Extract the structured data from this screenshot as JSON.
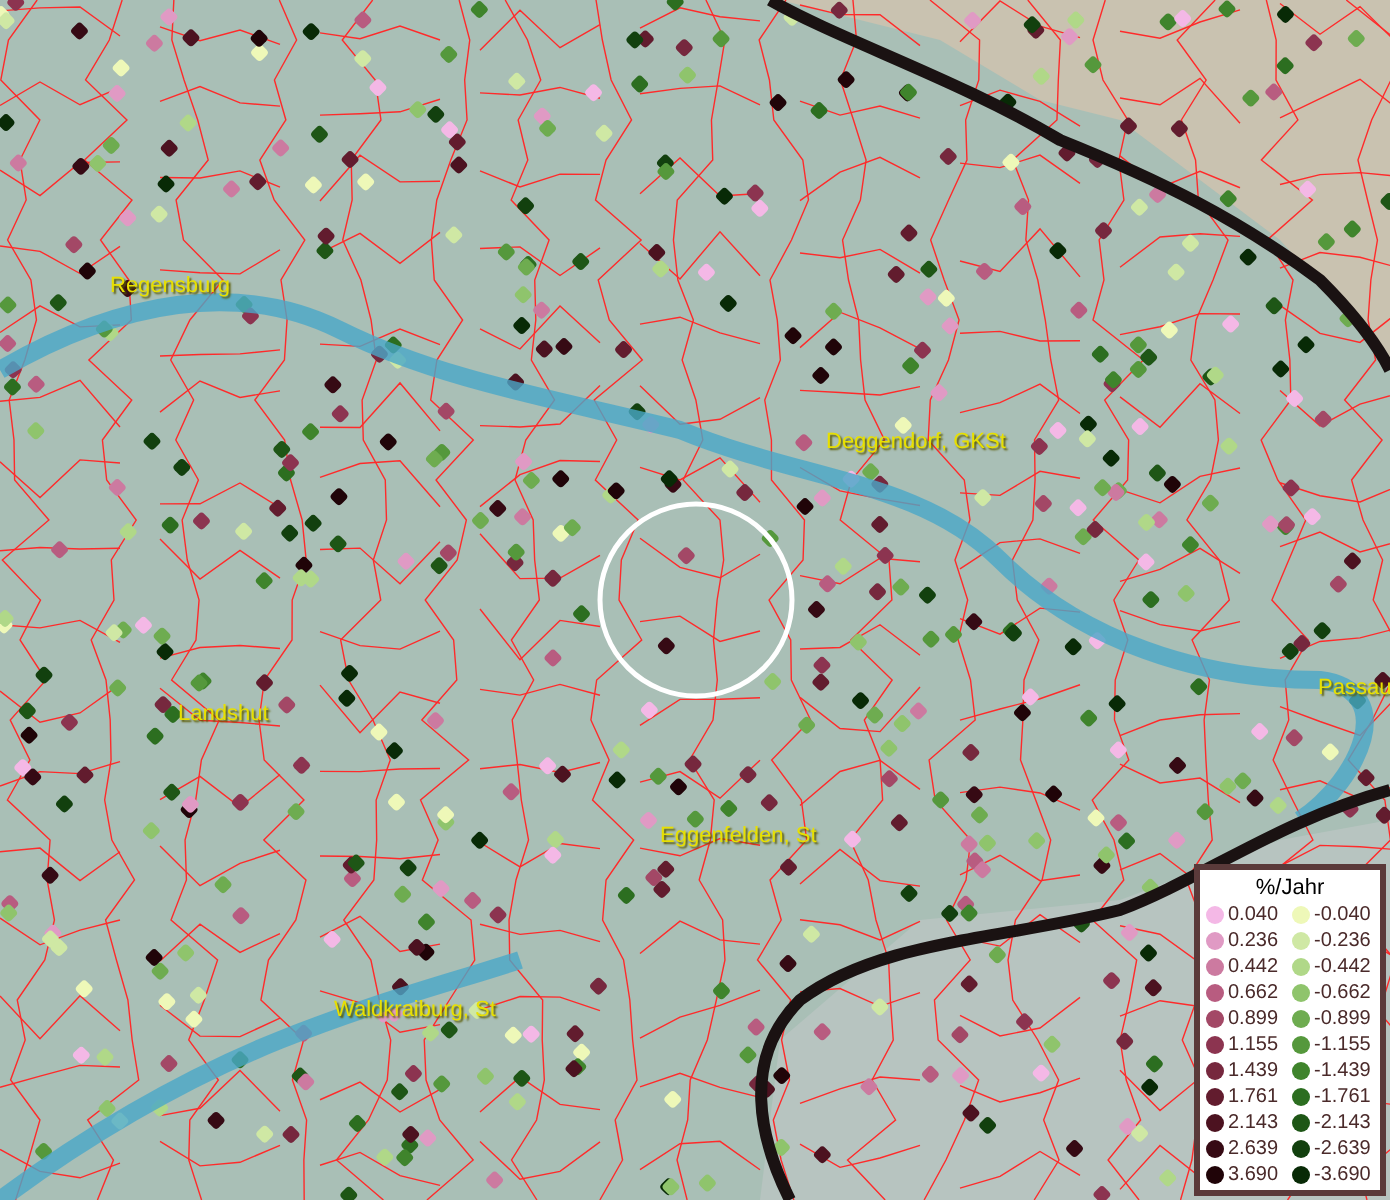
{
  "map": {
    "places": [
      {
        "name": "Regensburg"
      },
      {
        "name": "Deggendorf, GKSt"
      },
      {
        "name": "Landshut"
      },
      {
        "name": "Eggenfelden, St"
      },
      {
        "name": "Waldkraiburg, St"
      },
      {
        "name": "Passau"
      }
    ]
  },
  "legend": {
    "title": "%/Jahr",
    "entries": [
      {
        "value": "0.040",
        "color": "#f4b8e6"
      },
      {
        "value": "-0.040",
        "color": "#eef8b8"
      },
      {
        "value": "0.236",
        "color": "#e09ac4"
      },
      {
        "value": "-0.236",
        "color": "#cfe8a4"
      },
      {
        "value": "0.442",
        "color": "#cc7aa0"
      },
      {
        "value": "-0.442",
        "color": "#b0d888"
      },
      {
        "value": "0.662",
        "color": "#b85c80"
      },
      {
        "value": "-0.662",
        "color": "#8fc46c"
      },
      {
        "value": "0.899",
        "color": "#a34866"
      },
      {
        "value": "-0.899",
        "color": "#6eac50"
      },
      {
        "value": "1.155",
        "color": "#8c3450"
      },
      {
        "value": "-1.155",
        "color": "#55983c"
      },
      {
        "value": "1.439",
        "color": "#76283e"
      },
      {
        "value": "-1.439",
        "color": "#3f842c"
      },
      {
        "value": "1.761",
        "color": "#621c2e"
      },
      {
        "value": "-1.761",
        "color": "#2c6e20"
      },
      {
        "value": "2.143",
        "color": "#4c1220"
      },
      {
        "value": "-2.143",
        "color": "#1e5616"
      },
      {
        "value": "2.639",
        "color": "#360a14"
      },
      {
        "value": "-2.639",
        "color": "#12400e"
      },
      {
        "value": "3.690",
        "color": "#200408"
      },
      {
        "value": "-3.690",
        "color": "#082a06"
      }
    ]
  }
}
